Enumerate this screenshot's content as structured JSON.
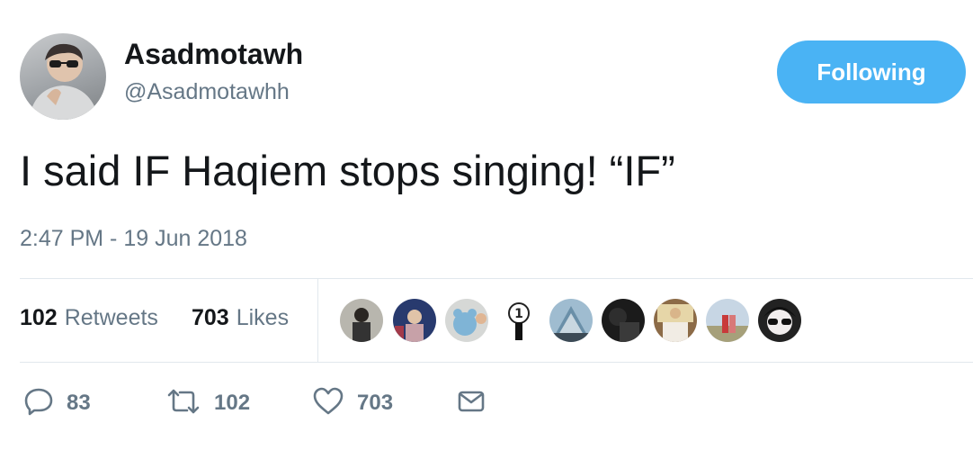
{
  "tweet": {
    "author": {
      "display_name": "Asadmotawh",
      "handle": "@Asadmotawhh",
      "avatar_icon": "profile-photo"
    },
    "follow_button_label": "Following",
    "text": "I said IF Haqiem stops singing! “IF”",
    "timestamp": "2:47 PM - 19 Jun 2018"
  },
  "stats": {
    "retweets_count": "102",
    "retweets_label": "Retweets",
    "likes_count": "703",
    "likes_label": "Likes"
  },
  "likers": [
    {
      "icon": "liker-avatar-1"
    },
    {
      "icon": "liker-avatar-2"
    },
    {
      "icon": "liker-avatar-3"
    },
    {
      "icon": "liker-avatar-4"
    },
    {
      "icon": "liker-avatar-5"
    },
    {
      "icon": "liker-avatar-6"
    },
    {
      "icon": "liker-avatar-7"
    },
    {
      "icon": "liker-avatar-8"
    },
    {
      "icon": "liker-avatar-9"
    }
  ],
  "actions": {
    "reply_count": "83",
    "retweet_count": "102",
    "like_count": "703",
    "icons": [
      "reply-icon",
      "retweet-icon",
      "like-icon",
      "message-icon"
    ]
  },
  "colors": {
    "accent": "#4ab3f4",
    "secondary_text": "#657786",
    "primary_text": "#14171a",
    "divider": "#e1e8ed"
  }
}
